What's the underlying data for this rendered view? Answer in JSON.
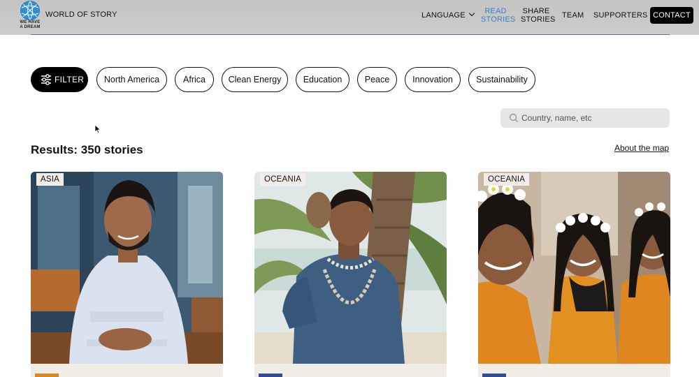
{
  "header": {
    "logo_text": "WE HAVE A DREAM",
    "site_title": "WORLD OF STORY",
    "nav": {
      "language": "LANGUAGE",
      "read_stories": "READ STORIES",
      "share_stories": "SHARE STORIES",
      "team": "TEAM",
      "supporters": "SUPPORTERS",
      "contact": "CONTACT"
    },
    "active_color": "#3a7ec8"
  },
  "filters": {
    "filter_label": "FILTER",
    "chips": [
      "North America",
      "Africa",
      "Clean Energy",
      "Education",
      "Peace",
      "Innovation",
      "Sustainability"
    ]
  },
  "search": {
    "placeholder": "Country, name, etc",
    "value": ""
  },
  "results": {
    "label": "Results: 350 stories",
    "about_link": "About the map"
  },
  "cards": [
    {
      "region": "ASIA",
      "photo_icon": "person-portrait"
    },
    {
      "region": "OCEANIA",
      "photo_icon": "person-portrait"
    },
    {
      "region": "OCEANIA",
      "photo_icon": "group-portrait"
    }
  ]
}
